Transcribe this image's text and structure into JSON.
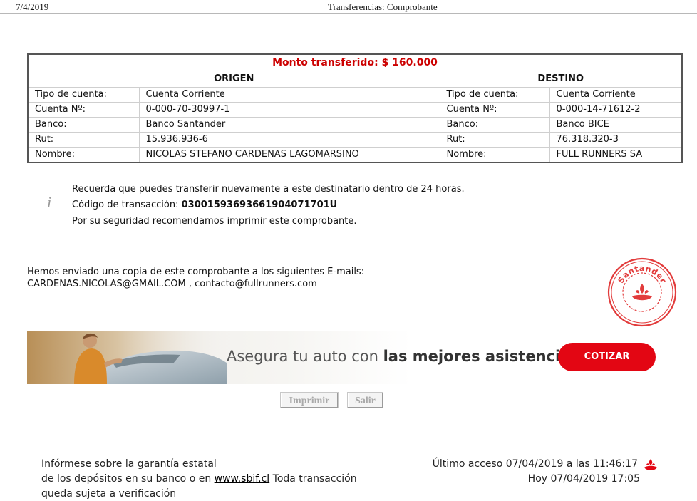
{
  "header": {
    "date": "7/4/2019",
    "title": "Transferencias: Comprobante"
  },
  "voucher": {
    "amount": "Monto transferido: $ 160.000",
    "origin_title": "ORIGEN",
    "destination_title": "DESTINO",
    "rows": [
      {
        "label": "Tipo de cuenta:",
        "origin": "Cuenta Corriente",
        "dest_label": "Tipo de cuenta:",
        "destination": "Cuenta Corriente"
      },
      {
        "label": "Cuenta Nº:",
        "origin": "0-000-70-30997-1",
        "dest_label": "Cuenta Nº:",
        "destination": "0-000-14-71612-2"
      },
      {
        "label": "Banco:",
        "origin": "Banco Santander",
        "dest_label": "Banco:",
        "destination": "Banco BICE"
      },
      {
        "label": "Rut:",
        "origin": "15.936.936-6",
        "dest_label": "Rut:",
        "destination": "76.318.320-3"
      },
      {
        "label": "Nombre:",
        "origin": "NICOLAS STEFANO CARDENAS LAGOMARSINO",
        "dest_label": "Nombre:",
        "destination": "FULL RUNNERS SA"
      }
    ]
  },
  "info": {
    "icon_char": "i",
    "reminder": "Recuerda que puedes transferir nuevamente a este destinatario dentro de 24 horas.",
    "code_label": "Código de transacción:",
    "code_value": "03001593693661904071701U",
    "security": "Por su seguridad recomendamos imprimir este comprobante."
  },
  "emails": {
    "intro": "Hemos enviado una copia de este comprobante a los siguientes E-mails:",
    "list": "CARDENAS.NICOLAS@GMAIL.COM , contacto@fullrunners.com"
  },
  "stamp": {
    "text": "Santander"
  },
  "banner": {
    "tagline_regular": "Asegura tu auto con ",
    "tagline_bold": "las mejores asistencias",
    "cta": "COTIZAR"
  },
  "buttons": {
    "print": "Imprimir",
    "exit": "Salir"
  },
  "footer": {
    "line1": "Infórmese sobre la garantía estatal",
    "line2_prefix": "de los depósitos en su banco o en ",
    "link": "www.sbif.cl",
    "line2_suffix": " Toda transacción",
    "line3": "queda sujeta a verificación",
    "last_access": "Último acceso 07/04/2019 a las 11:46:17",
    "today": "Hoy 07/04/2019 17:05"
  },
  "colors": {
    "brand_red": "#e30613",
    "amount_red": "#cc0000"
  },
  "icons": {
    "info": "info-icon",
    "logo": "santander-flame-icon"
  }
}
